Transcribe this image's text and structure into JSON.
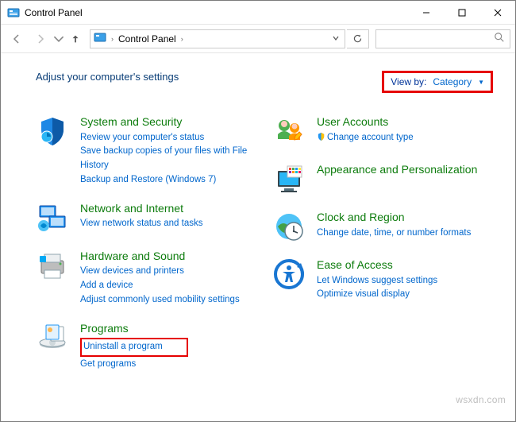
{
  "window": {
    "title": "Control Panel"
  },
  "address": {
    "path": "Control Panel",
    "sep": "›"
  },
  "heading": "Adjust your computer's settings",
  "viewby": {
    "label": "View by:",
    "value": "Category"
  },
  "left": [
    {
      "title": "System and Security",
      "links": [
        "Review your computer's status",
        "Save backup copies of your files with File History",
        "Backup and Restore (Windows 7)"
      ]
    },
    {
      "title": "Network and Internet",
      "links": [
        "View network status and tasks"
      ]
    },
    {
      "title": "Hardware and Sound",
      "links": [
        "View devices and printers",
        "Add a device",
        "Adjust commonly used mobility settings"
      ]
    },
    {
      "title": "Programs",
      "links": [
        "Uninstall a program",
        "Get programs"
      ]
    }
  ],
  "right": [
    {
      "title": "User Accounts",
      "links": [
        "Change account type"
      ]
    },
    {
      "title": "Appearance and Personalization",
      "links": []
    },
    {
      "title": "Clock and Region",
      "links": [
        "Change date, time, or number formats"
      ]
    },
    {
      "title": "Ease of Access",
      "links": [
        "Let Windows suggest settings",
        "Optimize visual display"
      ]
    }
  ],
  "watermark": "wsxdn.com"
}
